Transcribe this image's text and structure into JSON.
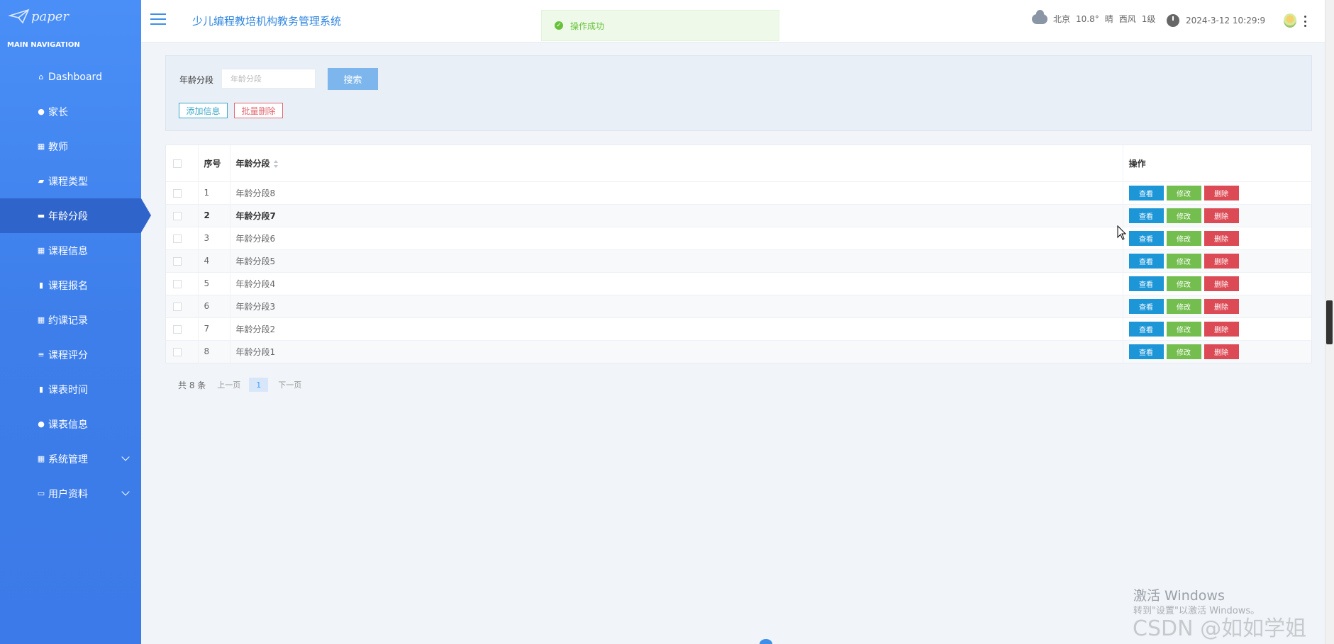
{
  "brand": {
    "logo_icon": "paper-plane-icon",
    "name": "paper"
  },
  "sidebar": {
    "caption": "MAIN NAVIGATION",
    "items": [
      {
        "label": "Dashboard",
        "icon": "home-icon",
        "glyph": "⌂"
      },
      {
        "label": "家长",
        "icon": "location-pin-icon",
        "glyph": "●"
      },
      {
        "label": "教师",
        "icon": "grid-icon",
        "glyph": "▦"
      },
      {
        "label": "课程类型",
        "icon": "ticket-icon",
        "glyph": "▰"
      },
      {
        "label": "年龄分段",
        "icon": "ticket-icon",
        "glyph": "▬",
        "active": true
      },
      {
        "label": "课程信息",
        "icon": "grid-icon",
        "glyph": "▦"
      },
      {
        "label": "课程报名",
        "icon": "bar-chart-icon",
        "glyph": "▮"
      },
      {
        "label": "约课记录",
        "icon": "grid-icon",
        "glyph": "▦"
      },
      {
        "label": "课程评分",
        "icon": "list-icon",
        "glyph": "≡"
      },
      {
        "label": "课表时间",
        "icon": "clipboard-icon",
        "glyph": "▮"
      },
      {
        "label": "课表信息",
        "icon": "user-icon",
        "glyph": "●"
      },
      {
        "label": "系统管理",
        "icon": "grid-icon",
        "glyph": "▦",
        "expandable": true
      },
      {
        "label": "用户资料",
        "icon": "card-icon",
        "glyph": "▭",
        "expandable": true
      }
    ]
  },
  "header": {
    "title": "少儿编程教培机构教务管理系统",
    "toast": "操作成功",
    "weather": {
      "city": "北京",
      "temp": "10.8°",
      "condition": "晴",
      "wind": "西风",
      "level": "1级"
    },
    "datetime": "2024-3-12 10:29:9"
  },
  "search": {
    "label": "年龄分段",
    "placeholder": "年龄分段",
    "button": "搜索",
    "add_button": "添加信息",
    "batch_delete_button": "批量删除"
  },
  "table": {
    "columns": [
      "序号",
      "年龄分段",
      "操作"
    ],
    "rows": [
      {
        "index": "1",
        "name": "年龄分段8"
      },
      {
        "index": "2",
        "name": "年龄分段7"
      },
      {
        "index": "3",
        "name": "年龄分段6"
      },
      {
        "index": "4",
        "name": "年龄分段5"
      },
      {
        "index": "5",
        "name": "年龄分段4"
      },
      {
        "index": "6",
        "name": "年龄分段3"
      },
      {
        "index": "7",
        "name": "年龄分段2"
      },
      {
        "index": "8",
        "name": "年龄分段1"
      }
    ],
    "actions": {
      "view": "查看",
      "edit": "修改",
      "delete": "删除"
    }
  },
  "pagination": {
    "total": "共 8 条",
    "prev": "上一页",
    "current": "1",
    "next": "下一页"
  },
  "overlay": {
    "watermark": "激活 Windows",
    "watermark_sub": "转到\"设置\"以激活 Windows。",
    "csdn": "CSDN @如如学姐"
  },
  "colors": {
    "sidebar": "#3d7eea",
    "active": "#2f65cb",
    "view": "#1d96d8",
    "edit": "#74bd4f",
    "delete": "#dc4a55"
  }
}
